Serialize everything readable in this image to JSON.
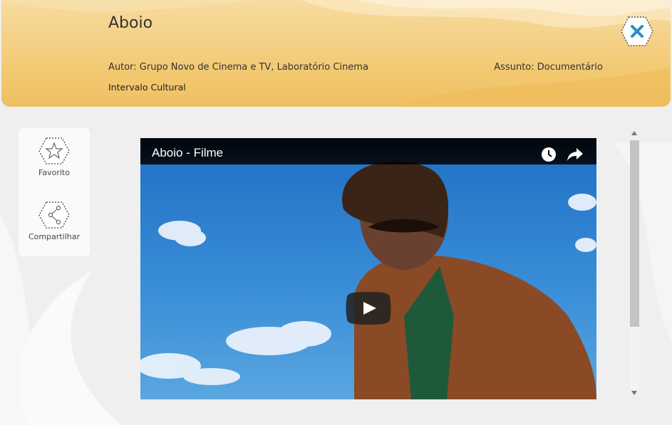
{
  "header": {
    "title": "Aboio",
    "author": "Autor: Grupo Novo de Cinema e TV, Laboratório Cinema",
    "subject": "Assunto: Documentário",
    "collection": "Intervalo Cultural"
  },
  "sidebar": {
    "favorite_label": "Favorito",
    "share_label": "Compartilhar"
  },
  "video": {
    "title": "Aboio - Filme"
  },
  "icons": {
    "close": "close-icon",
    "favorite": "star-icon",
    "share": "share-nodes-icon",
    "watch_later": "clock-icon",
    "video_share": "share-arrow-icon",
    "play": "play-icon"
  },
  "colors": {
    "header": "#f2c870",
    "close_accent": "#2a8fc8",
    "play_button": "#212121"
  }
}
